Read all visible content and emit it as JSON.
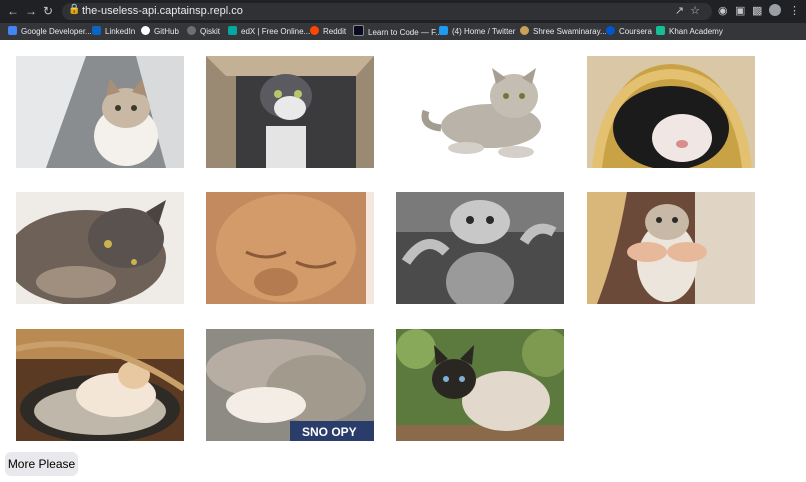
{
  "browser": {
    "url": "the-useless-api.captainsp.repl.co",
    "bookmarks": [
      {
        "label": "Google Developer...",
        "color": "#4285f4"
      },
      {
        "label": "LinkedIn",
        "color": "#0a66c2"
      },
      {
        "label": "GitHub",
        "color": "#ffffff"
      },
      {
        "label": "Qiskit",
        "color": "#6f6f6f"
      },
      {
        "label": "edX | Free Online...",
        "color": "#02262b"
      },
      {
        "label": "Reddit",
        "color": "#ff4500"
      },
      {
        "label": "Learn to Code — F...",
        "color": "#0a0a23"
      },
      {
        "label": "(4) Home / Twitter",
        "color": "#1d9bf0"
      },
      {
        "label": "Shree Swaminaray...",
        "color": "#c9a15a"
      },
      {
        "label": "Coursera",
        "color": "#0056d2"
      },
      {
        "label": "Khan Academy",
        "color": "#14bf96"
      }
    ]
  },
  "gallery": {
    "button_label": "More Please"
  }
}
